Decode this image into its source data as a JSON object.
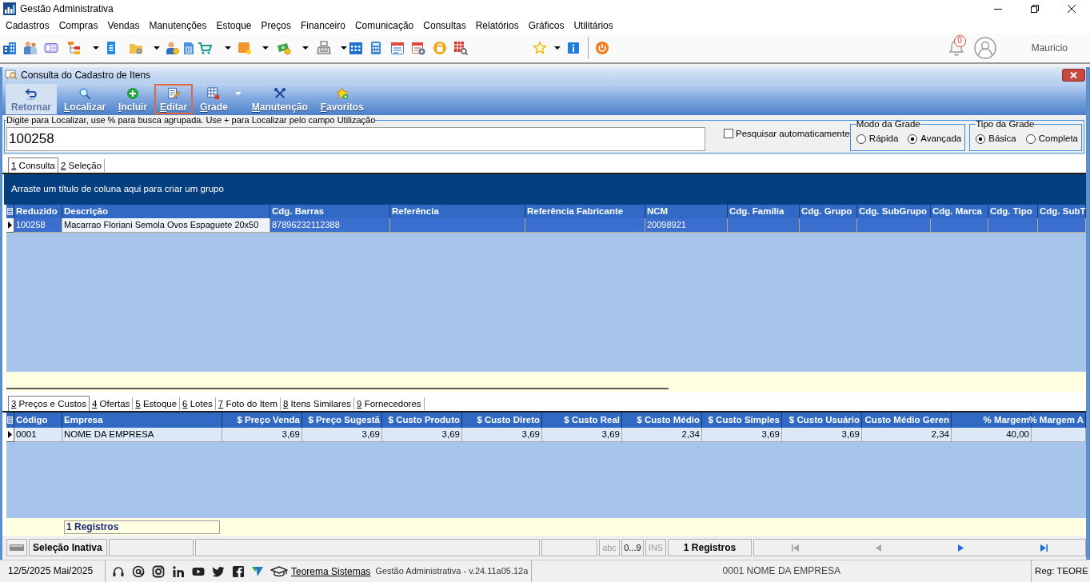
{
  "app": {
    "title": "Gestão Administrativa"
  },
  "menu": [
    "Cadastros",
    "Compras",
    "Vendas",
    "Manutenções",
    "Estoque",
    "Preços",
    "Financeiro",
    "Comunicação",
    "Consultas",
    "Relatórios",
    "Gráficos",
    "Utilitários"
  ],
  "header": {
    "notification_count": "0",
    "user_name": "Mauricio"
  },
  "window": {
    "title": "Consulta do Cadastro de Itens"
  },
  "actions": [
    {
      "label": "Retornar",
      "disabled": true,
      "focused": false,
      "dropdown": false,
      "mnemonic": false
    },
    {
      "label": "Localizar",
      "disabled": false,
      "focused": false,
      "dropdown": false,
      "mnemonic": true
    },
    {
      "label": "Incluir",
      "disabled": false,
      "focused": false,
      "dropdown": false,
      "mnemonic": true
    },
    {
      "label": "Editar",
      "disabled": false,
      "focused": true,
      "dropdown": false,
      "mnemonic": true
    },
    {
      "label": "Grade",
      "disabled": false,
      "focused": false,
      "dropdown": true,
      "mnemonic": true
    },
    {
      "label": "Manutenção",
      "disabled": false,
      "focused": false,
      "dropdown": false,
      "mnemonic": true
    },
    {
      "label": "Favoritos",
      "disabled": false,
      "focused": false,
      "dropdown": false,
      "mnemonic": true
    }
  ],
  "search": {
    "caption": "Digite para Localizar, use % para busca agrupada. Use + para Localizar pelo campo Utilização",
    "value": "100258"
  },
  "auto_search": {
    "label": "Pesquisar automaticamente",
    "checked": false
  },
  "grid_options": [
    {
      "title": "Modo da Grade",
      "options": [
        {
          "label": "Rápida",
          "selected": false
        },
        {
          "label": "Avançada",
          "selected": true
        }
      ]
    },
    {
      "title": "Tipo da Grade",
      "options": [
        {
          "label": "Básica",
          "selected": true
        },
        {
          "label": "Completa",
          "selected": false
        }
      ]
    }
  ],
  "main_tabs": [
    {
      "label": "1 Consulta",
      "selected": true,
      "mnemonic": true
    },
    {
      "label": "2 Seleção",
      "selected": false,
      "mnemonic": true
    }
  ],
  "group_panel": {
    "hint": "Arraste um título de coluna aqui para criar um grupo"
  },
  "items_table": {
    "columns": [
      "Reduzido",
      "Descrição",
      "Cdg. Barras",
      "Referência",
      "Referência Fabricante",
      "NCM",
      "Cdg. Família",
      "Cdg. Grupo",
      "Cdg. SubGrupo",
      "Cdg. Marca",
      "Cdg. Tipo",
      "Cdg. SubT"
    ],
    "rows": [
      {
        "current": true,
        "selected": true,
        "cells": [
          {
            "text": "100258",
            "focused": false
          },
          {
            "text": "Macarrao Floriani Semola Ovos Espaguete 20x50",
            "focused": true
          },
          {
            "text": "87896232112388",
            "focused": false
          },
          {
            "focused": false
          },
          {
            "focused": false
          },
          {
            "text": "20098921",
            "focused": false
          }
        ]
      }
    ]
  },
  "detail_tabs": [
    {
      "label": "3 Preços e Custos",
      "selected": true,
      "mnemonic": true
    },
    {
      "label": "4 Ofertas",
      "selected": false,
      "mnemonic": true
    },
    {
      "label": "5 Estoque",
      "selected": false,
      "mnemonic": true
    },
    {
      "label": "6 Lotes",
      "selected": false,
      "mnemonic": true
    },
    {
      "label": "7 Foto do Item",
      "selected": false,
      "mnemonic": true
    },
    {
      "label": "8 Itens Similares",
      "selected": false,
      "mnemonic": true
    },
    {
      "label": "9 Fornecedores",
      "selected": false,
      "mnemonic": true
    }
  ],
  "prices_table": {
    "columns": [
      {
        "label": "Código",
        "kind": "text"
      },
      {
        "label": "Empresa",
        "kind": "text"
      },
      {
        "label": "$ Preço Venda",
        "kind": "number"
      },
      {
        "label": "$ Preço Sugestã",
        "kind": "number"
      },
      {
        "label": "$ Custo Produto",
        "kind": "number"
      },
      {
        "label": "$ Custo Direto",
        "kind": "number"
      },
      {
        "label": "$ Custo Real",
        "kind": "number"
      },
      {
        "label": "$ Custo Médio",
        "kind": "number"
      },
      {
        "label": "$ Custo Simples",
        "kind": "number"
      },
      {
        "label": "$ Custo Usuário",
        "kind": "number"
      },
      {
        "label": "Custo Médio Geren",
        "kind": "number"
      },
      {
        "label": "% Margem",
        "kind": "number"
      },
      {
        "label": "% Margem A",
        "kind": "number"
      }
    ],
    "rows": [
      {
        "current": true,
        "selected": false,
        "cells": [
          "0001",
          "NOME DA EMPRESA",
          "3,69",
          "3,69",
          "3,69",
          "3,69",
          "3,69",
          "2,34",
          "3,69",
          "3,69",
          "2,34",
          "40,00"
        ]
      }
    ],
    "footer": "1 Registros"
  },
  "status_bar": {
    "selection": "Seleção Inativa",
    "indicators": [
      {
        "label": "abc",
        "active": false
      },
      {
        "label": "0...9",
        "active": true
      },
      {
        "label": "INS",
        "active": false
      }
    ],
    "records": "1 Registros",
    "navigator": [
      {
        "kind": "first",
        "disabled": true
      },
      {
        "kind": "prev",
        "disabled": true
      },
      {
        "kind": "next",
        "disabled": false
      },
      {
        "kind": "last",
        "disabled": false
      }
    ]
  },
  "footer_bar": {
    "date": "12/5/2025 Mai/2025",
    "link": "Teorema Sistemas",
    "version": "Gestão Administrativa - v.24.11a05.12a",
    "company": "0001 NOME DA EMPRESA",
    "registration": "Reg: TEORE"
  }
}
